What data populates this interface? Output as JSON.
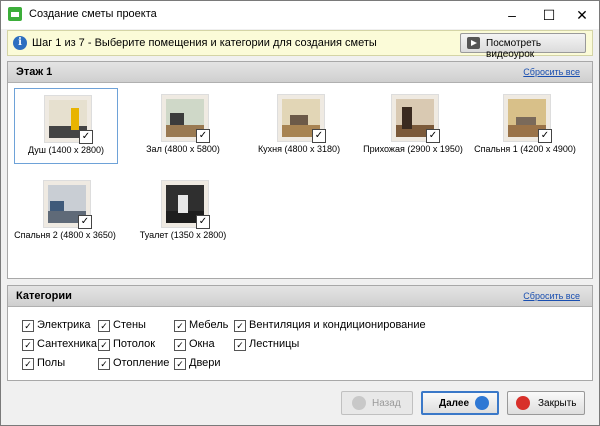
{
  "window": {
    "title": "Создание сметы проекта",
    "controls": {
      "minimize": "–",
      "maximize": "☐",
      "close": "✕"
    }
  },
  "step_bar": {
    "text": "Шаг 1 из 7 - Выберите помещения и категории для создания сметы",
    "video_button": "Посмотреть видеоурок",
    "info_icon": "i"
  },
  "rooms_panel": {
    "title": "Этаж 1",
    "reset": "Сбросить все",
    "rooms": [
      {
        "label": "Душ (1400 x 2800)",
        "checked": true,
        "selected": true
      },
      {
        "label": "Зал (4800 x 5800)",
        "checked": true
      },
      {
        "label": "Кухня (4800 x 3180)",
        "checked": true
      },
      {
        "label": "Прихожая (2900 x 1950)",
        "checked": true
      },
      {
        "label": "Спальня 1 (4200 x 4900)",
        "checked": true
      },
      {
        "label": "Спальня 2 (4800 x 3650)",
        "checked": true
      },
      {
        "label": "Туалет (1350 x 2800)",
        "checked": true
      }
    ]
  },
  "categories_panel": {
    "title": "Категории",
    "reset": "Сбросить все",
    "items": [
      {
        "label": "Электрика",
        "checked": true
      },
      {
        "label": "Сантехника",
        "checked": true
      },
      {
        "label": "Полы",
        "checked": true
      },
      {
        "label": "Стены",
        "checked": true
      },
      {
        "label": "Потолок",
        "checked": true
      },
      {
        "label": "Отопление",
        "checked": true
      },
      {
        "label": "Мебель",
        "checked": true
      },
      {
        "label": "Окна",
        "checked": true
      },
      {
        "label": "Двери",
        "checked": true
      },
      {
        "label": "Вентиляция и кондиционирование",
        "checked": true
      },
      {
        "label": "Лестницы",
        "checked": true
      }
    ]
  },
  "footer": {
    "back": "Назад",
    "next": "Далее",
    "close": "Закрыть"
  },
  "check_glyph": "✓"
}
